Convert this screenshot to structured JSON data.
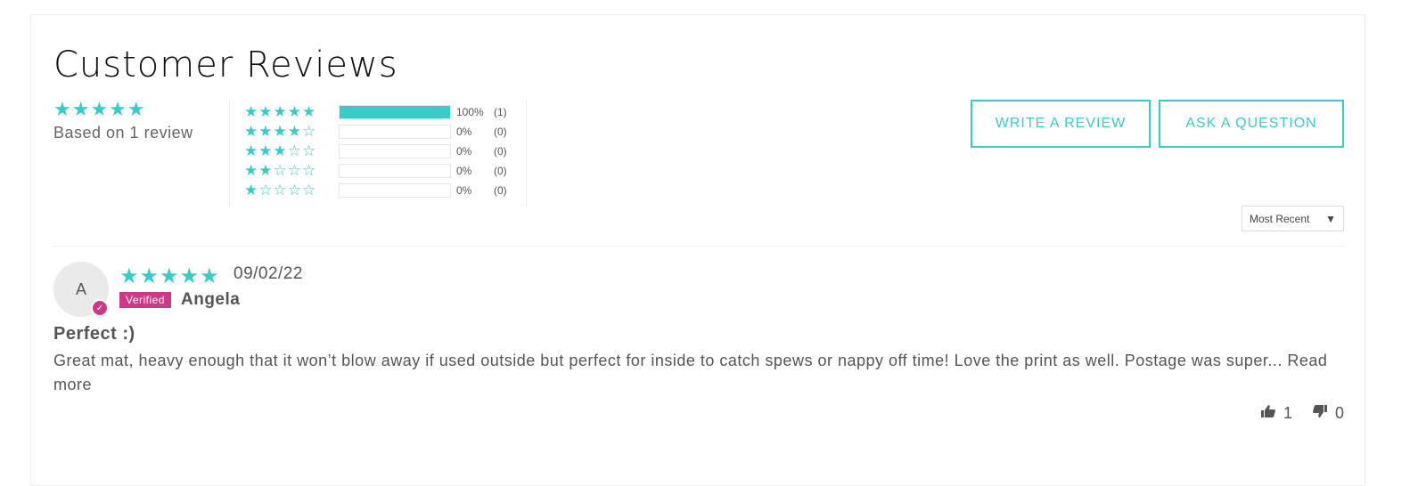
{
  "title": "Customer Reviews",
  "summary": {
    "stars": "★★★★★",
    "based_on": "Based on 1 review"
  },
  "histogram": [
    {
      "stars": "★★★★★",
      "percent": "100%",
      "count": "(1)",
      "fill": 1.0
    },
    {
      "stars": "★★★★☆",
      "percent": "0%",
      "count": "(0)",
      "fill": 0
    },
    {
      "stars": "★★★☆☆",
      "percent": "0%",
      "count": "(0)",
      "fill": 0
    },
    {
      "stars": "★★☆☆☆",
      "percent": "0%",
      "count": "(0)",
      "fill": 0
    },
    {
      "stars": "★☆☆☆☆",
      "percent": "0%",
      "count": "(0)",
      "fill": 0
    }
  ],
  "buttons": {
    "write_review": "WRITE A REVIEW",
    "ask_question": "ASK A QUESTION"
  },
  "sort": {
    "selected": "Most Recent",
    "arrow": "▼"
  },
  "review": {
    "avatar_initial": "A",
    "check_glyph": "✓",
    "stars": "★★★★★",
    "date": "09/02/22",
    "verified_label": "Verified",
    "author": "Angela",
    "title": "Perfect :)",
    "body": "Great mat, heavy enough that it won’t blow away if used outside but perfect for inside to catch spews or nappy off time! Love the print as well. Postage was super...",
    "read_more": "Read more",
    "thumbs_up_count": "1",
    "thumbs_down_count": "0"
  },
  "icons": {
    "thumbs_up": "thumbs-up-icon",
    "thumbs_down": "thumbs-down-icon",
    "check": "check-icon"
  },
  "colors": {
    "accent": "#3ccac7",
    "verified": "#cc3a86"
  }
}
